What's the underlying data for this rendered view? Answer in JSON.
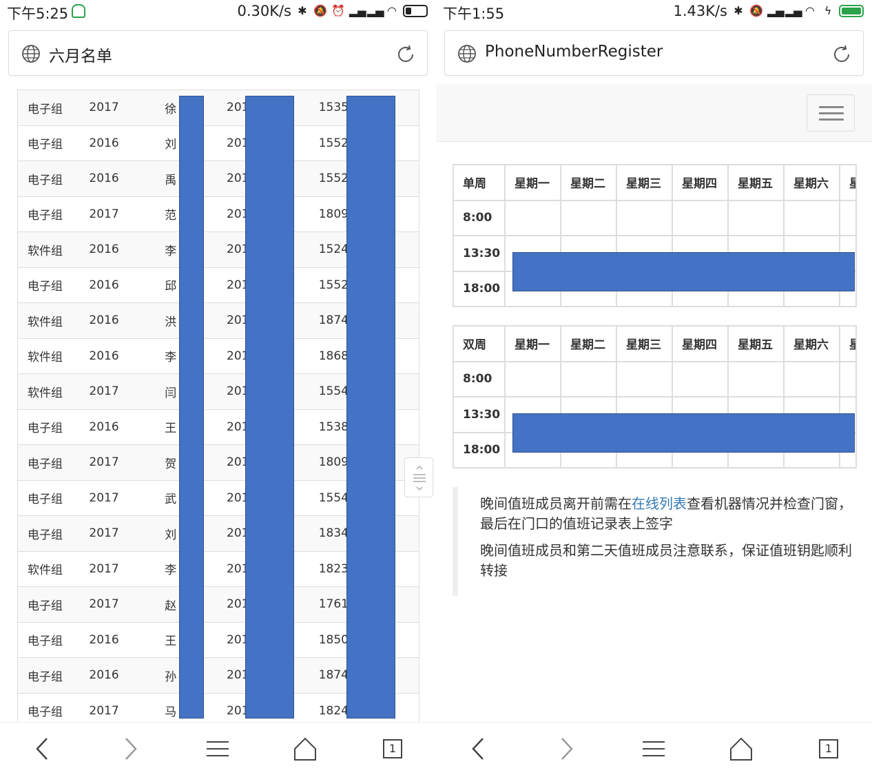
{
  "left": {
    "status": {
      "time": "下午5:25",
      "speed": "0.30K/s"
    },
    "address": {
      "title": "六月名单"
    },
    "rows": [
      {
        "group": "电子组",
        "year": "2017",
        "name": "徐",
        "id": "201",
        "phone": "1535"
      },
      {
        "group": "电子组",
        "year": "2016",
        "name": "刘",
        "id": "201",
        "phone": "1552"
      },
      {
        "group": "电子组",
        "year": "2016",
        "name": "禹",
        "id": "201",
        "phone": "1552"
      },
      {
        "group": "电子组",
        "year": "2017",
        "name": "范",
        "id": "201",
        "phone": "1809"
      },
      {
        "group": "软件组",
        "year": "2016",
        "name": "李",
        "id": "201",
        "phone": "1524"
      },
      {
        "group": "电子组",
        "year": "2016",
        "name": "邱",
        "id": "201",
        "phone": "1552"
      },
      {
        "group": "软件组",
        "year": "2016",
        "name": "洪",
        "id": "201",
        "phone": "1874"
      },
      {
        "group": "软件组",
        "year": "2016",
        "name": "李",
        "id": "201",
        "phone": "1868"
      },
      {
        "group": "软件组",
        "year": "2017",
        "name": "闫",
        "id": "201",
        "phone": "1554"
      },
      {
        "group": "电子组",
        "year": "2016",
        "name": "王",
        "id": "201",
        "phone": "1538"
      },
      {
        "group": "电子组",
        "year": "2017",
        "name": "贺",
        "id": "201",
        "phone": "1809"
      },
      {
        "group": "电子组",
        "year": "2017",
        "name": "武",
        "id": "201",
        "phone": "1554"
      },
      {
        "group": "电子组",
        "year": "2017",
        "name": "刘",
        "id": "201",
        "phone": "1834"
      },
      {
        "group": "软件组",
        "year": "2017",
        "name": "李",
        "id": "201",
        "phone": "1823"
      },
      {
        "group": "电子组",
        "year": "2017",
        "name": "赵",
        "id": "201",
        "phone": "1761"
      },
      {
        "group": "电子组",
        "year": "2016",
        "name": "王",
        "id": "201",
        "phone": "1850"
      },
      {
        "group": "电子组",
        "year": "2016",
        "name": "孙",
        "id": "201",
        "phone": "1874"
      },
      {
        "group": "电子组",
        "year": "2017",
        "name": "马",
        "id": "201",
        "phone": "1824"
      }
    ],
    "tab_count": "1"
  },
  "right": {
    "status": {
      "time": "下午1:55",
      "speed": "1.43K/s"
    },
    "address": {
      "title": "PhoneNumberRegister"
    },
    "single_week": {
      "headers": [
        "单周",
        "星期一",
        "星期二",
        "星期三",
        "星期四",
        "星期五",
        "星期六",
        "星"
      ],
      "times": [
        "8:00",
        "13:30",
        "18:00"
      ]
    },
    "double_week": {
      "headers": [
        "双周",
        "星期一",
        "星期二",
        "星期三",
        "星期四",
        "星期五",
        "星期六",
        "星"
      ],
      "times": [
        "8:00",
        "13:30",
        "18:00"
      ]
    },
    "note": {
      "p1_before": "晚间值班成员离开前需在",
      "p1_link": "在线列表",
      "p1_after": "查看机器情况并检查门窗，最后在门口的值班记录表上签字",
      "p2": "晚间值班成员和第二天值班成员注意联系，保证值班钥匙顺利转接"
    },
    "tab_count": "1"
  },
  "colors": {
    "redaction": "#4472c4",
    "link": "#337ab7",
    "charging": "#2aa34a"
  },
  "icons": [
    "globe-icon",
    "reload-icon",
    "back-icon",
    "forward-icon",
    "menu-icon",
    "home-icon",
    "tabs-icon",
    "hamburger-icon",
    "wifi-icon",
    "signal-icon",
    "bluetooth-icon",
    "mute-icon",
    "alarm-icon",
    "battery-icon"
  ]
}
